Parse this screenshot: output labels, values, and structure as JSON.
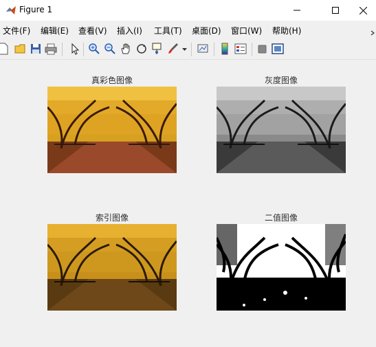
{
  "window": {
    "title": "Figure 1",
    "controls": {
      "minimize": "—",
      "maximize": "☐",
      "close": "✕"
    }
  },
  "menu": {
    "items": [
      "文件(F)",
      "编辑(E)",
      "查看(V)",
      "插入(I)",
      "工具(T)",
      "桌面(D)",
      "窗口(W)",
      "帮助(H)"
    ]
  },
  "toolbar": {
    "icons": [
      "new-figure-icon",
      "open-file-icon",
      "save-icon",
      "print-icon",
      "edit-plot-icon",
      "zoom-in-icon",
      "zoom-out-icon",
      "pan-icon",
      "rotate-3d-icon",
      "data-cursor-icon",
      "brush-icon",
      "brush-dropdown-icon",
      "link-plot-icon",
      "insert-colorbar-icon",
      "insert-legend-icon",
      "hide-plot-tools-icon",
      "show-plot-tools-icon"
    ]
  },
  "subplots": [
    {
      "title": "真彩色图像",
      "palette": "truecolor"
    },
    {
      "title": "灰度图像",
      "palette": "grayscale"
    },
    {
      "title": "索引图像",
      "palette": "indexed"
    },
    {
      "title": "二值图像",
      "palette": "binary"
    }
  ],
  "colors": {
    "window_bg": "#f0f0f0",
    "titlebar_bg": "#ffffff",
    "close_hover": "#e81123"
  }
}
